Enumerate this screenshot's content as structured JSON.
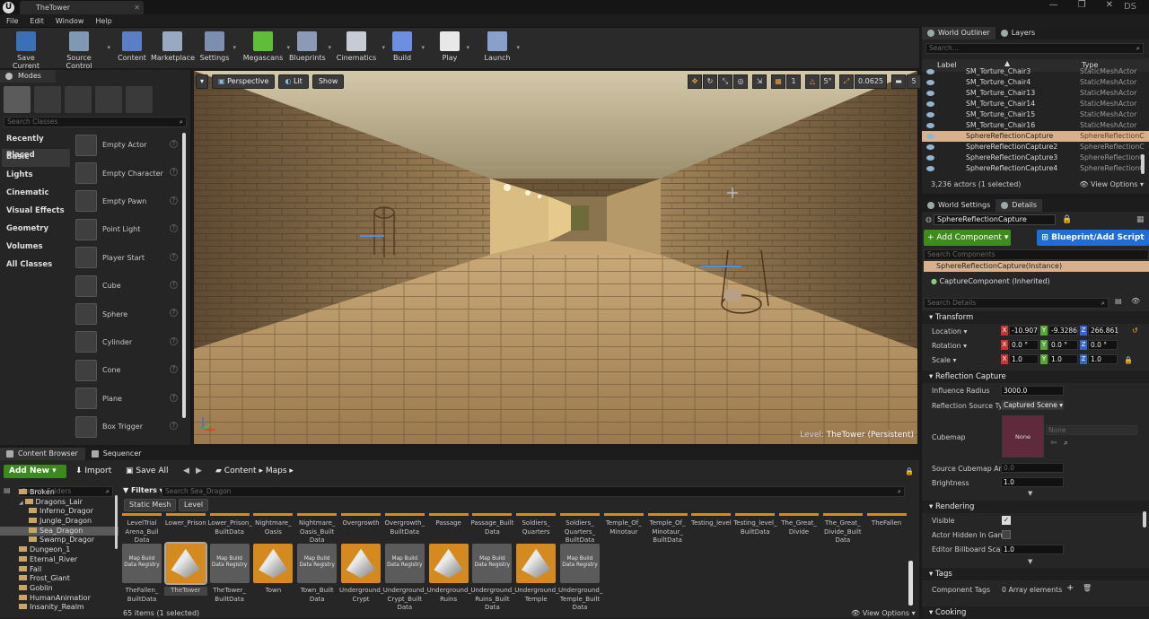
{
  "window": {
    "tab_title": "TheTower",
    "user_badge": "DS"
  },
  "menu": [
    "File",
    "Edit",
    "Window",
    "Help"
  ],
  "toolbar": [
    {
      "label": "Save Current",
      "icon": "save-icon",
      "color": "#3b6fb8"
    },
    {
      "label": "Source Control",
      "icon": "source-control-icon",
      "color": "#7f98b3"
    },
    {
      "label": "Content",
      "icon": "content-icon",
      "color": "#5b7fc7"
    },
    {
      "label": "Marketplace",
      "icon": "marketplace-icon",
      "color": "#9aa9c2"
    },
    {
      "label": "Settings",
      "icon": "settings-icon",
      "color": "#7c8fae"
    },
    {
      "label": "Megascans",
      "icon": "megascans-icon",
      "color": "#5fbd3a"
    },
    {
      "label": "Blueprints",
      "icon": "blueprints-icon",
      "color": "#8a9bb7"
    },
    {
      "label": "Cinematics",
      "icon": "cinematics-icon",
      "color": "#c7cbd4"
    },
    {
      "label": "Build",
      "icon": "build-icon",
      "color": "#6c8fe0"
    },
    {
      "label": "Play",
      "icon": "play-icon",
      "color": "#e8e8e8"
    },
    {
      "label": "Launch",
      "icon": "launch-icon",
      "color": "#8aa0cc"
    }
  ],
  "modes": {
    "title": "Modes",
    "search_placeholder": "Search Classes",
    "categories": [
      "Recently Placed",
      "Basic",
      "Lights",
      "Cinematic",
      "Visual Effects",
      "Geometry",
      "Volumes",
      "All Classes"
    ],
    "selected_category": "Basic",
    "items": [
      "Empty Actor",
      "Empty Character",
      "Empty Pawn",
      "Point Light",
      "Player Start",
      "Cube",
      "Sphere",
      "Cylinder",
      "Cone",
      "Plane",
      "Box Trigger"
    ]
  },
  "viewport": {
    "buttons": [
      "Perspective",
      "Lit",
      "Show"
    ],
    "snap_values": [
      "1",
      "5°",
      "0.0625",
      "5"
    ],
    "level_label": "Level:",
    "level_name": "TheTower (Persistent)"
  },
  "outliner": {
    "tabs": [
      "World Outliner",
      "Layers"
    ],
    "search_placeholder": "Search...",
    "col_label": "Label",
    "col_type": "Type",
    "rows": [
      {
        "name": "SM_Torture_Chair3",
        "type": "StaticMeshActor"
      },
      {
        "name": "SM_Torture_Chair4",
        "type": "StaticMeshActor"
      },
      {
        "name": "SM_Torture_Chair13",
        "type": "StaticMeshActor"
      },
      {
        "name": "SM_Torture_Chair14",
        "type": "StaticMeshActor"
      },
      {
        "name": "SM_Torture_Chair15",
        "type": "StaticMeshActor"
      },
      {
        "name": "SM_Torture_Chair16",
        "type": "StaticMeshActor"
      },
      {
        "name": "SphereReflectionCapture",
        "type": "SphereReflectionC",
        "selected": true
      },
      {
        "name": "SphereReflectionCapture2",
        "type": "SphereReflectionC"
      },
      {
        "name": "SphereReflectionCapture3",
        "type": "SphereReflectionC"
      },
      {
        "name": "SphereReflectionCapture4",
        "type": "SphereReflectionC"
      }
    ],
    "status": "3,236 actors (1 selected)",
    "view_options": "View Options"
  },
  "details": {
    "tabs": [
      "World Settings",
      "Details"
    ],
    "actor_name": "SphereReflectionCapture",
    "add_component": "+ Add Component",
    "blueprint": "Blueprint/Add Script",
    "search_components": "Search Components",
    "instance": "SphereReflectionCapture(Instance)",
    "component": "CaptureComponent (Inherited)",
    "search_details": "Search Details",
    "sections": {
      "transform": "Transform",
      "reflection": "Reflection Capture",
      "rendering": "Rendering",
      "tags": "Tags",
      "cooking": "Cooking"
    },
    "location": {
      "label": "Location",
      "x": "-10.907",
      "y": "-9.3286",
      "z": "266.861"
    },
    "rotation": {
      "label": "Rotation",
      "x": "0.0 °",
      "y": "0.0 °",
      "z": "0.0 °"
    },
    "scale": {
      "label": "Scale",
      "x": "1.0",
      "y": "1.0",
      "z": "1.0"
    },
    "influence": {
      "label": "Influence Radius",
      "value": "3000.0"
    },
    "source_type": {
      "label": "Reflection Source Typ",
      "value": "Captured Scene"
    },
    "cubemap": {
      "label": "Cubemap",
      "thumb": "None",
      "value": "None"
    },
    "cubemap_angle": {
      "label": "Source Cubemap Angl",
      "value": "0.0"
    },
    "brightness": {
      "label": "Brightness",
      "value": "1.0"
    },
    "visible": {
      "label": "Visible"
    },
    "hidden": {
      "label": "Actor Hidden In Game"
    },
    "billboard": {
      "label": "Editor Billboard Scale",
      "value": "1.0"
    },
    "tags": {
      "label": "Component Tags",
      "value": "0 Array elements"
    }
  },
  "content_browser": {
    "tabs": [
      "Content Browser",
      "Sequencer"
    ],
    "add_new": "Add New",
    "import": "Import",
    "save_all": "Save All",
    "path": [
      "Content",
      "Maps"
    ],
    "search_folders": "Search Folders",
    "filters": "Filters",
    "search_assets": "Search Sea_Dragon",
    "filter_chips": [
      "Static Mesh",
      "Level"
    ],
    "folders": [
      {
        "name": "Broken",
        "indent": 2
      },
      {
        "name": "Dragons_Lair",
        "indent": 2,
        "open": true
      },
      {
        "name": "Inferno_Dragor",
        "indent": 3
      },
      {
        "name": "Jungle_Dragon",
        "indent": 3
      },
      {
        "name": "Sea_Dragon",
        "indent": 3,
        "selected": true
      },
      {
        "name": "Swamp_Dragor",
        "indent": 3
      },
      {
        "name": "Dungeon_1",
        "indent": 2
      },
      {
        "name": "Eternal_River",
        "indent": 2
      },
      {
        "name": "Fail",
        "indent": 2
      },
      {
        "name": "Frost_Giant",
        "indent": 2
      },
      {
        "name": "Goblin",
        "indent": 2
      },
      {
        "name": "HumanAnimatior",
        "indent": 2
      },
      {
        "name": "Insanity_Realm",
        "indent": 2
      }
    ],
    "top_row": [
      "LevelTrial\nArena_Buil\nData",
      "Lower_Prison",
      "Lower_Prison_\nBuiltData",
      "Nightmare_\nOasis",
      "Nightmare_\nOasis_Built\nData",
      "Overgrowth",
      "Overgrowth_\nBuiltData",
      "Passage",
      "Passage_Built\nData",
      "Soldiers_\nQuarters",
      "Soldiers_\nQuarters_\nBuiltData",
      "Temple_Of_\nMinotaur",
      "Temple_Of_\nMinotaur_\nBuiltData",
      "Testing_level",
      "Testing_level_\nBuiltData",
      "The_Great_\nDivide",
      "The_Great_\nDivide_Built\nData",
      "TheFallen"
    ],
    "bottom_row": [
      {
        "name": "TheFallen_\nBuiltData",
        "kind": "mbd"
      },
      {
        "name": "TheTower",
        "kind": "lvl",
        "selected": true
      },
      {
        "name": "TheTower_\nBuiltData",
        "kind": "mbd"
      },
      {
        "name": "Town",
        "kind": "lvl"
      },
      {
        "name": "Town_Built\nData",
        "kind": "mbd"
      },
      {
        "name": "Underground_\nCrypt",
        "kind": "lvl"
      },
      {
        "name": "Underground_\nCrypt_Built\nData",
        "kind": "mbd"
      },
      {
        "name": "Underground_\nRuins",
        "kind": "lvl"
      },
      {
        "name": "Underground_\nRuins_Built\nData",
        "kind": "mbd"
      },
      {
        "name": "Underground_\nTemple",
        "kind": "lvl"
      },
      {
        "name": "Underground_\nTemple_Built\nData",
        "kind": "mbd"
      }
    ],
    "mbd_label": "Map Build\nData Registry",
    "status": "65 items (1 selected)",
    "view_options": "View Options"
  }
}
